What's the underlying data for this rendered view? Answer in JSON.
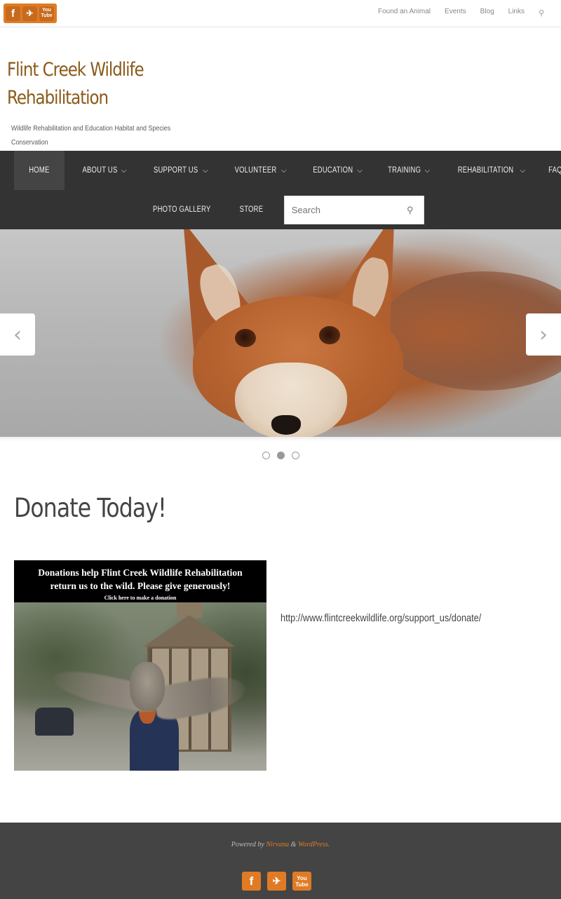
{
  "top": {
    "social": [
      {
        "name": "facebook",
        "glyph": "f"
      },
      {
        "name": "twitter",
        "glyph": "🐦"
      },
      {
        "name": "youtube",
        "glyph": "You Tube"
      }
    ],
    "menu": [
      "Found an Animal",
      "Events",
      "Blog",
      "Links"
    ]
  },
  "header": {
    "title": "Flint Creek Wildlife Rehabilitation",
    "description": "Wildlife Rehabilitation and Education Habitat and Species Conservation"
  },
  "nav": {
    "items": [
      {
        "label": "HOME",
        "dropdown": false
      },
      {
        "label": "ABOUT US",
        "dropdown": true
      },
      {
        "label": "SUPPORT US",
        "dropdown": true
      },
      {
        "label": "VOLUNTEER",
        "dropdown": true
      },
      {
        "label": "EDUCATION",
        "dropdown": true
      },
      {
        "label": "TRAINING",
        "dropdown": true
      },
      {
        "label": "REHABILITATION",
        "dropdown": true
      },
      {
        "label": "FAQ",
        "dropdown": false
      },
      {
        "label": "PHOTO GALLERY",
        "dropdown": false
      },
      {
        "label": "STORE",
        "dropdown": false
      }
    ],
    "search_placeholder": "Search"
  },
  "slider": {
    "prev": "‹",
    "next": "›",
    "active_index": 2,
    "count": 3
  },
  "content": {
    "title": "Donate Today!",
    "banner_line1": "Donations help Flint Creek Wildlife Rehabilitation",
    "banner_line2": "return us to the wild.  Please give generously!",
    "banner_line3": "Click here to make a donation",
    "link": "http://www.flintcreekwildlife.org/support_us/donate/"
  },
  "footer": {
    "powered_by": "Powered by",
    "nirvana": "Nirvana",
    "amp": "&",
    "wordpress": "WordPress."
  },
  "colors": {
    "accent": "#e07b25",
    "title": "#8a5a19",
    "nav_bg": "#333333",
    "footer_bg": "#444444"
  }
}
